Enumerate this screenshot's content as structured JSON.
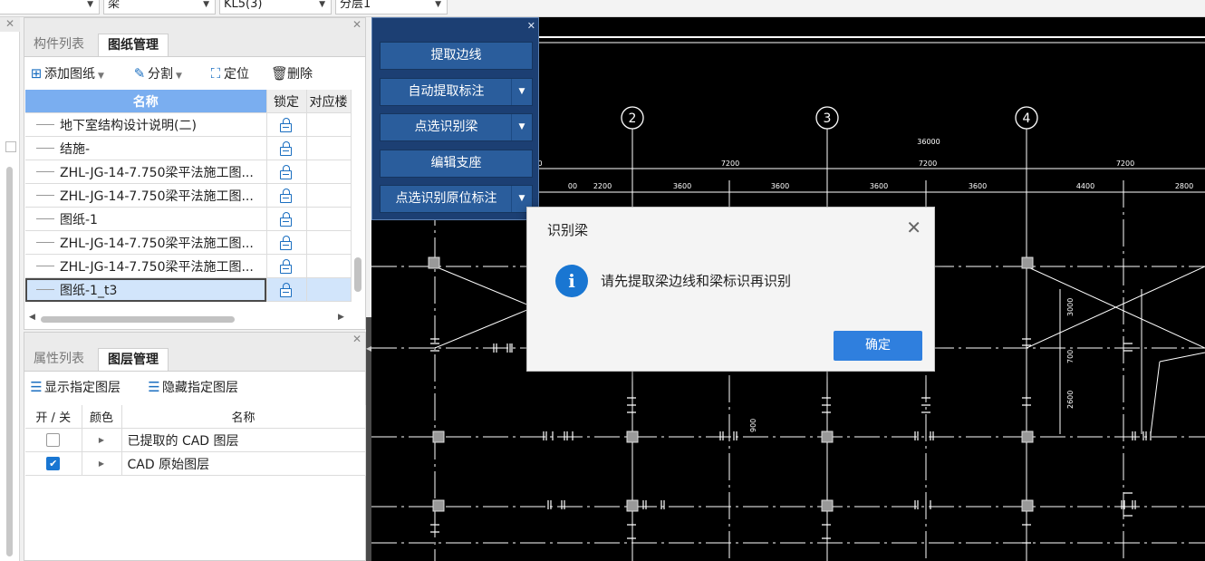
{
  "top_selects": [
    {
      "value": "梁"
    },
    {
      "value": "KL5(3)"
    },
    {
      "value": "分层1"
    }
  ],
  "drawing_panel": {
    "tabs": [
      "构件列表",
      "图纸管理"
    ],
    "active_tab": "图纸管理",
    "toolbar": {
      "add": "添加图纸",
      "split": "分割",
      "locate": "定位",
      "delete": "删除"
    },
    "columns": [
      "名称",
      "锁定",
      "对应楼"
    ],
    "rows": [
      {
        "name": "地下室结构设计说明(二)"
      },
      {
        "name": "结施-"
      },
      {
        "name": "ZHL-JG-14-7.750梁平法施工图..."
      },
      {
        "name": "ZHL-JG-14-7.750梁平法施工图..."
      },
      {
        "name": "图纸-1"
      },
      {
        "name": "ZHL-JG-14-7.750梁平法施工图..."
      },
      {
        "name": "ZHL-JG-14-7.750梁平法施工图..."
      },
      {
        "name": "图纸-1_t3",
        "selected": true
      }
    ]
  },
  "layer_panel": {
    "tabs": [
      "属性列表",
      "图层管理"
    ],
    "active_tab": "图层管理",
    "toolbar": {
      "show": "显示指定图层",
      "hide": "隐藏指定图层"
    },
    "columns": [
      "开 / 关",
      "颜色",
      "名称"
    ],
    "rows": [
      {
        "checked": false,
        "name": "已提取的 CAD 图层"
      },
      {
        "checked": true,
        "name": "CAD 原始图层"
      }
    ]
  },
  "recognize_panel": {
    "buttons": [
      {
        "label": "提取边线",
        "dropdown": false
      },
      {
        "label": "自动提取标注",
        "dropdown": true
      },
      {
        "label": "点选识别梁",
        "dropdown": true
      },
      {
        "label": "编辑支座",
        "dropdown": false
      },
      {
        "label": "点选识别原位标注",
        "dropdown": true
      }
    ]
  },
  "dialog": {
    "title": "识别梁",
    "message": "请先提取梁边线和梁标识再识别",
    "ok_label": "确定"
  },
  "cad": {
    "axes": [
      "2",
      "3",
      "4"
    ],
    "overall_dim": "36000",
    "dims_row1": [
      "0",
      "7200",
      "7200",
      "7200"
    ],
    "dims_row2": [
      "00",
      "2200",
      "3600",
      "3600",
      "3600",
      "3600",
      "4400",
      "2800"
    ],
    "vertical_dims": [
      "3000",
      "700",
      "2600",
      "900"
    ]
  },
  "colors": {
    "accent": "#1976d2",
    "panel_blue": "#1c3f73",
    "button_blue": "#2a5d9c",
    "header_blue": "#7aaef0",
    "selected_row": "#d2e5fb"
  }
}
